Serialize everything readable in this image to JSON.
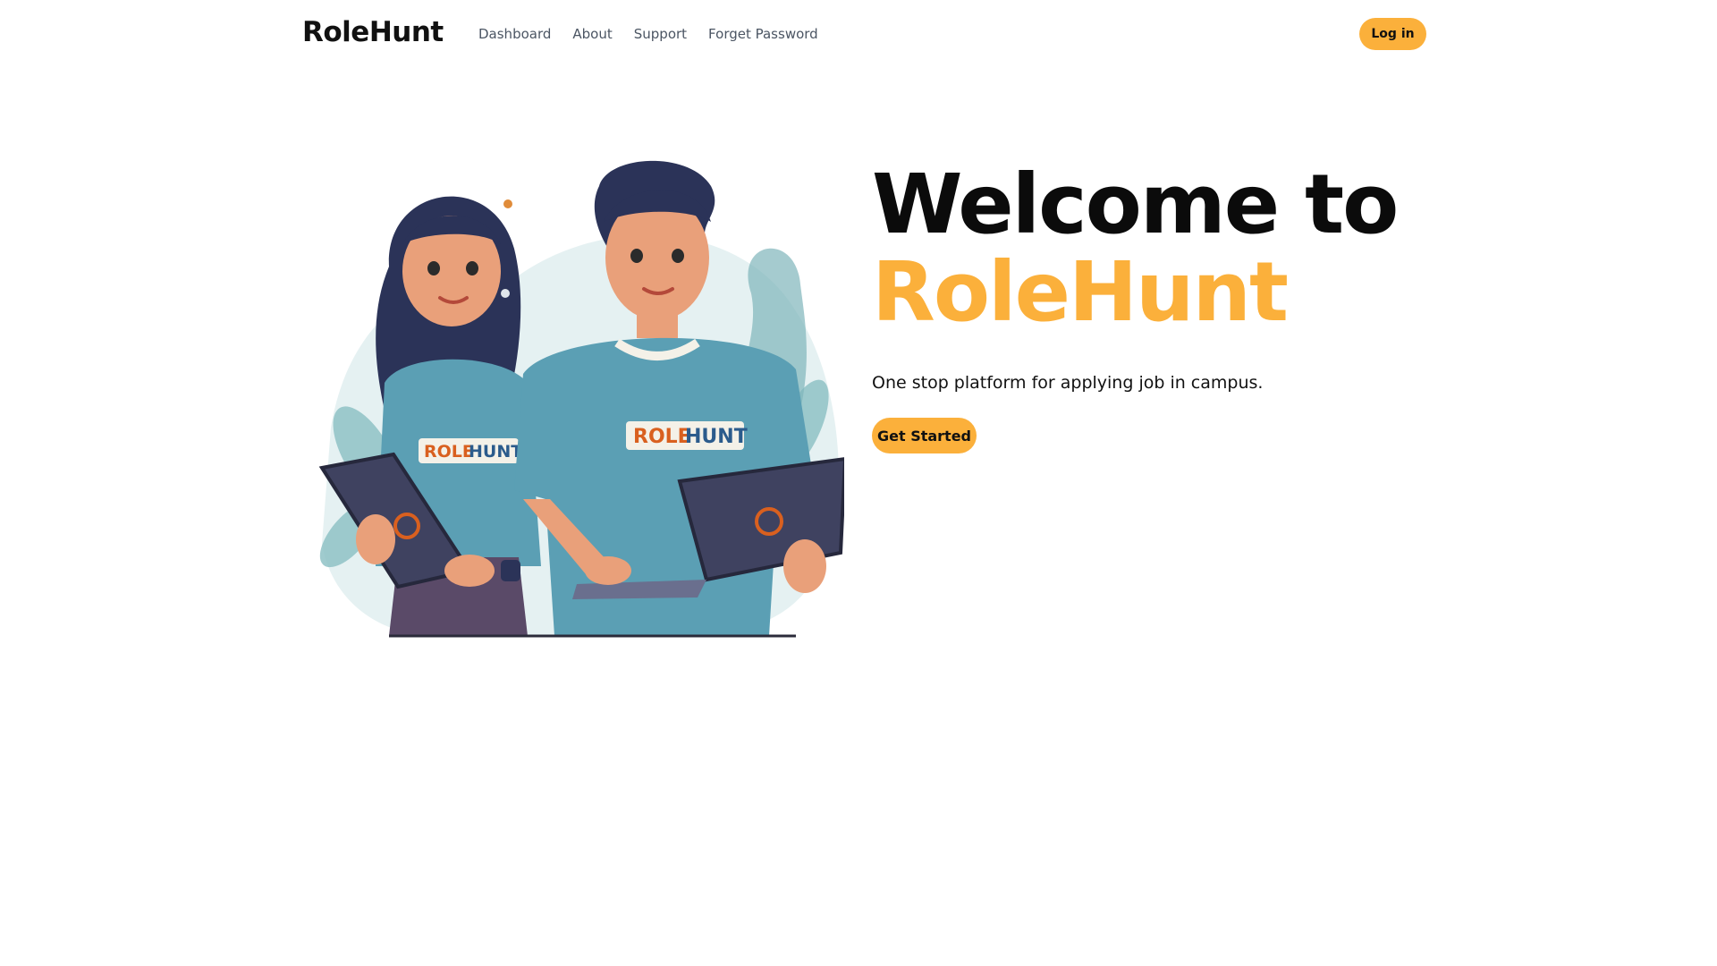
{
  "nav": {
    "brand": "RoleHunt",
    "links": [
      {
        "label": "Dashboard"
      },
      {
        "label": "About"
      },
      {
        "label": "Support"
      },
      {
        "label": "Forget Password"
      }
    ],
    "login_label": "Log in"
  },
  "hero": {
    "title_line1": "Welcome to",
    "title_line2": "RoleHunt",
    "tagline": "One stop platform for applying job in campus.",
    "cta_label": "Get Started",
    "illustration": {
      "shirt_text_left": "ROLE",
      "shirt_text_right": "HUNT",
      "icon": "students-with-laptops-illustration"
    }
  },
  "colors": {
    "accent": "#fbb03b",
    "text": "#111111",
    "nav_link": "#4b5563",
    "shirt": "#5b9fb4",
    "laptop": "#3f4260",
    "hair": "#2b3358",
    "skin": "#e9a07a"
  }
}
